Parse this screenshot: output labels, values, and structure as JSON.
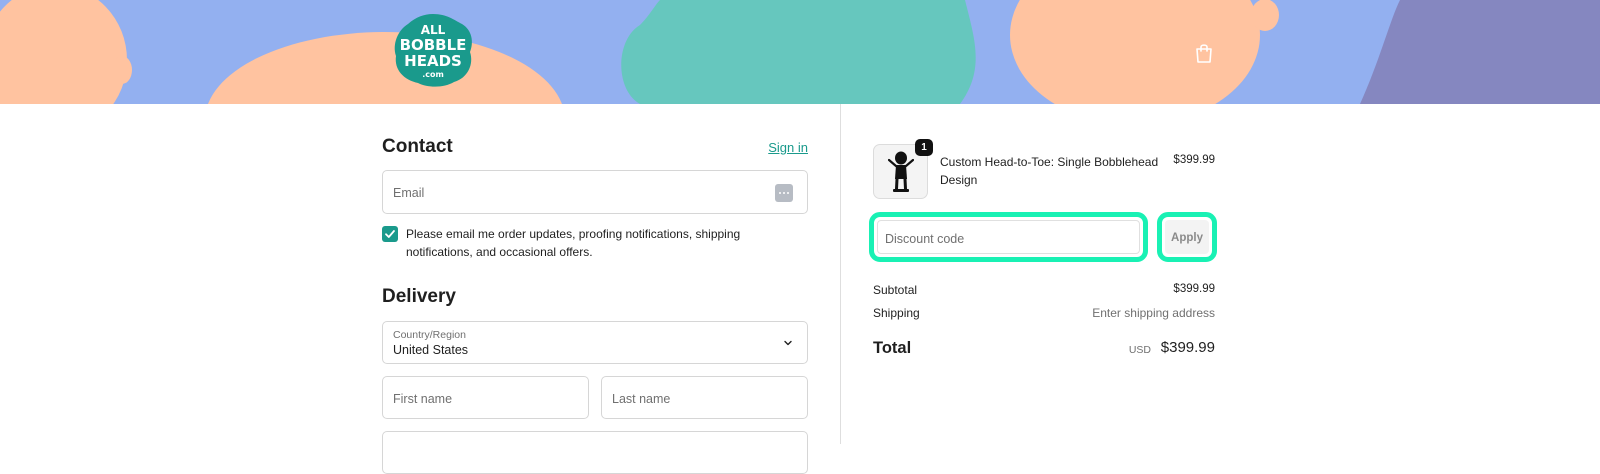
{
  "header": {
    "logo_text": "ALL BOBBLE HEADS .com",
    "cart_icon": "shopping-bag-icon",
    "colors": {
      "banner": "#93b0f0",
      "peach": "#ffc3a0",
      "teal": "#66c7be",
      "purple": "#8587c0",
      "brand": "#1a9a8c"
    }
  },
  "contact": {
    "title": "Contact",
    "sign_in": "Sign in",
    "email_placeholder": "Email",
    "email_icon": "password-manager-icon",
    "opt_in_checked": true,
    "opt_in_text": "Please email me order updates, proofing notifications, shipping notifications, and occasional offers."
  },
  "delivery": {
    "title": "Delivery",
    "country_label": "Country/Region",
    "country_value": "United States",
    "first_name_placeholder": "First name",
    "last_name_placeholder": "Last name"
  },
  "summary": {
    "product": {
      "name": "Custom Head-to-Toe: Single Bobblehead Design",
      "price": "$399.99",
      "quantity": "1"
    },
    "discount_placeholder": "Discount code",
    "apply_label": "Apply",
    "highlight_color": "#19f1b4",
    "subtotal_label": "Subtotal",
    "subtotal_value": "$399.99",
    "shipping_label": "Shipping",
    "shipping_value": "Enter shipping address",
    "total_label": "Total",
    "total_currency": "USD",
    "total_value": "$399.99"
  }
}
